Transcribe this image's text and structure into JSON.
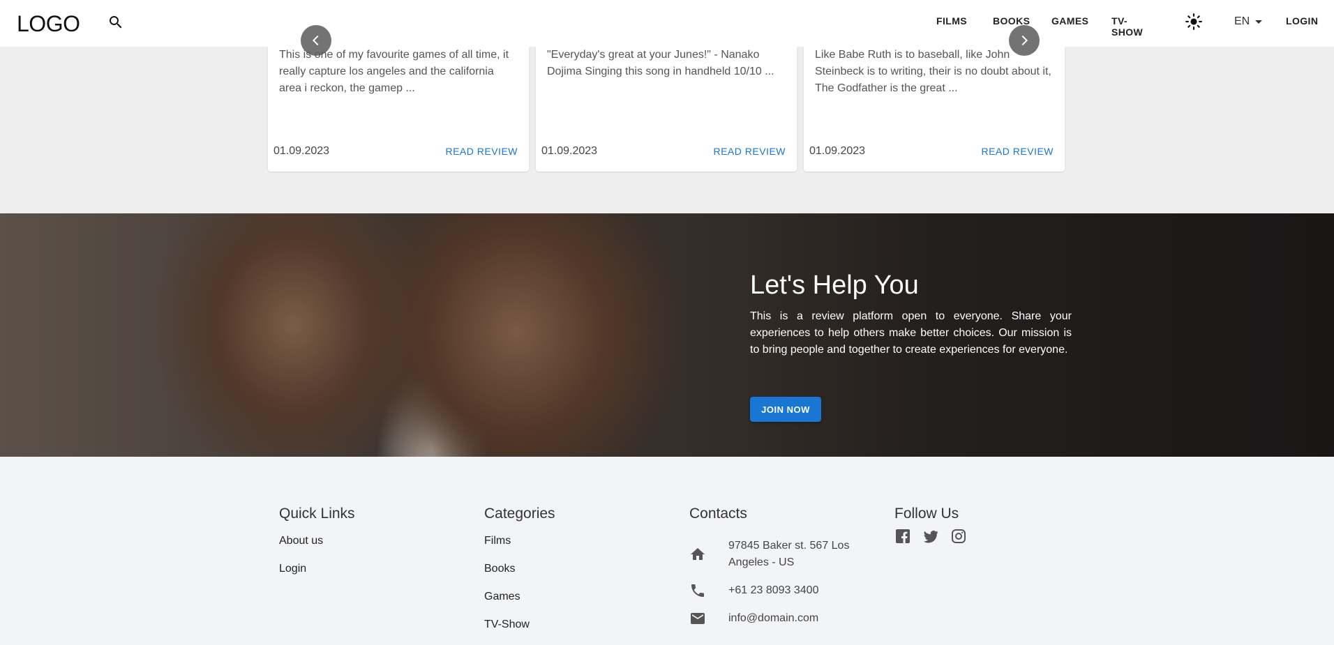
{
  "header": {
    "logo": "LOGO",
    "nav": [
      "FILMS",
      "BOOKS",
      "GAMES",
      "TV-SHOW"
    ],
    "language": "EN",
    "login": "LOGIN"
  },
  "reviews": [
    {
      "excerpt": "This is one of my favourite games of all time, it really capture los angeles and the california area i reckon, the gamep ...",
      "date": "01.09.2023",
      "link": "READ REVIEW"
    },
    {
      "excerpt": "\"Everyday's great at your Junes!\" - Nanako Dojima Singing this song in handheld 10/10 ...",
      "date": "01.09.2023",
      "link": "READ REVIEW"
    },
    {
      "excerpt": "Like Babe Ruth is to baseball, like John Steinbeck is to writing, their is no doubt about it, The Godfather is the great ...",
      "date": "01.09.2023",
      "link": "READ REVIEW"
    }
  ],
  "hero": {
    "title": "Let's Help You",
    "text": "This is a review platform open to everyone. Share your experiences to help others make better choices. Our mission is to bring people and together to create experiences for everyone.",
    "button": "JOIN NOW"
  },
  "footer": {
    "quick_links": {
      "title": "Quick Links",
      "items": [
        "About us",
        "Login"
      ]
    },
    "categories": {
      "title": "Categories",
      "items": [
        "Films",
        "Books",
        "Games",
        "TV-Show"
      ]
    },
    "contacts": {
      "title": "Contacts",
      "address": "97845 Baker st. 567 Los Angeles - US",
      "phone": "+61 23 8093 3400",
      "email": "info@domain.com"
    },
    "follow": {
      "title": "Follow Us",
      "icons": [
        "facebook-icon",
        "twitter-icon",
        "instagram-icon"
      ]
    }
  },
  "colors": {
    "accent": "#1976d2",
    "footer_bg": "#f3f4f7",
    "page_bg": "#eeeeee"
  }
}
